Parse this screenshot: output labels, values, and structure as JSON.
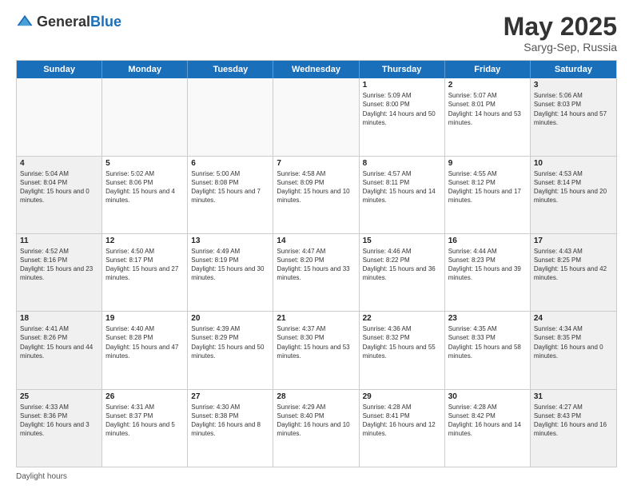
{
  "header": {
    "logo_general": "General",
    "logo_blue": "Blue",
    "title": "May 2025",
    "location": "Saryg-Sep, Russia"
  },
  "calendar": {
    "days": [
      "Sunday",
      "Monday",
      "Tuesday",
      "Wednesday",
      "Thursday",
      "Friday",
      "Saturday"
    ],
    "rows": [
      [
        {
          "day": "",
          "content": ""
        },
        {
          "day": "",
          "content": ""
        },
        {
          "day": "",
          "content": ""
        },
        {
          "day": "",
          "content": ""
        },
        {
          "day": "1",
          "content": "Sunrise: 5:09 AM\nSunset: 8:00 PM\nDaylight: 14 hours and 50 minutes."
        },
        {
          "day": "2",
          "content": "Sunrise: 5:07 AM\nSunset: 8:01 PM\nDaylight: 14 hours and 53 minutes."
        },
        {
          "day": "3",
          "content": "Sunrise: 5:06 AM\nSunset: 8:03 PM\nDaylight: 14 hours and 57 minutes."
        }
      ],
      [
        {
          "day": "4",
          "content": "Sunrise: 5:04 AM\nSunset: 8:04 PM\nDaylight: 15 hours and 0 minutes."
        },
        {
          "day": "5",
          "content": "Sunrise: 5:02 AM\nSunset: 8:06 PM\nDaylight: 15 hours and 4 minutes."
        },
        {
          "day": "6",
          "content": "Sunrise: 5:00 AM\nSunset: 8:08 PM\nDaylight: 15 hours and 7 minutes."
        },
        {
          "day": "7",
          "content": "Sunrise: 4:58 AM\nSunset: 8:09 PM\nDaylight: 15 hours and 10 minutes."
        },
        {
          "day": "8",
          "content": "Sunrise: 4:57 AM\nSunset: 8:11 PM\nDaylight: 15 hours and 14 minutes."
        },
        {
          "day": "9",
          "content": "Sunrise: 4:55 AM\nSunset: 8:12 PM\nDaylight: 15 hours and 17 minutes."
        },
        {
          "day": "10",
          "content": "Sunrise: 4:53 AM\nSunset: 8:14 PM\nDaylight: 15 hours and 20 minutes."
        }
      ],
      [
        {
          "day": "11",
          "content": "Sunrise: 4:52 AM\nSunset: 8:16 PM\nDaylight: 15 hours and 23 minutes."
        },
        {
          "day": "12",
          "content": "Sunrise: 4:50 AM\nSunset: 8:17 PM\nDaylight: 15 hours and 27 minutes."
        },
        {
          "day": "13",
          "content": "Sunrise: 4:49 AM\nSunset: 8:19 PM\nDaylight: 15 hours and 30 minutes."
        },
        {
          "day": "14",
          "content": "Sunrise: 4:47 AM\nSunset: 8:20 PM\nDaylight: 15 hours and 33 minutes."
        },
        {
          "day": "15",
          "content": "Sunrise: 4:46 AM\nSunset: 8:22 PM\nDaylight: 15 hours and 36 minutes."
        },
        {
          "day": "16",
          "content": "Sunrise: 4:44 AM\nSunset: 8:23 PM\nDaylight: 15 hours and 39 minutes."
        },
        {
          "day": "17",
          "content": "Sunrise: 4:43 AM\nSunset: 8:25 PM\nDaylight: 15 hours and 42 minutes."
        }
      ],
      [
        {
          "day": "18",
          "content": "Sunrise: 4:41 AM\nSunset: 8:26 PM\nDaylight: 15 hours and 44 minutes."
        },
        {
          "day": "19",
          "content": "Sunrise: 4:40 AM\nSunset: 8:28 PM\nDaylight: 15 hours and 47 minutes."
        },
        {
          "day": "20",
          "content": "Sunrise: 4:39 AM\nSunset: 8:29 PM\nDaylight: 15 hours and 50 minutes."
        },
        {
          "day": "21",
          "content": "Sunrise: 4:37 AM\nSunset: 8:30 PM\nDaylight: 15 hours and 53 minutes."
        },
        {
          "day": "22",
          "content": "Sunrise: 4:36 AM\nSunset: 8:32 PM\nDaylight: 15 hours and 55 minutes."
        },
        {
          "day": "23",
          "content": "Sunrise: 4:35 AM\nSunset: 8:33 PM\nDaylight: 15 hours and 58 minutes."
        },
        {
          "day": "24",
          "content": "Sunrise: 4:34 AM\nSunset: 8:35 PM\nDaylight: 16 hours and 0 minutes."
        }
      ],
      [
        {
          "day": "25",
          "content": "Sunrise: 4:33 AM\nSunset: 8:36 PM\nDaylight: 16 hours and 3 minutes."
        },
        {
          "day": "26",
          "content": "Sunrise: 4:31 AM\nSunset: 8:37 PM\nDaylight: 16 hours and 5 minutes."
        },
        {
          "day": "27",
          "content": "Sunrise: 4:30 AM\nSunset: 8:38 PM\nDaylight: 16 hours and 8 minutes."
        },
        {
          "day": "28",
          "content": "Sunrise: 4:29 AM\nSunset: 8:40 PM\nDaylight: 16 hours and 10 minutes."
        },
        {
          "day": "29",
          "content": "Sunrise: 4:28 AM\nSunset: 8:41 PM\nDaylight: 16 hours and 12 minutes."
        },
        {
          "day": "30",
          "content": "Sunrise: 4:28 AM\nSunset: 8:42 PM\nDaylight: 16 hours and 14 minutes."
        },
        {
          "day": "31",
          "content": "Sunrise: 4:27 AM\nSunset: 8:43 PM\nDaylight: 16 hours and 16 minutes."
        }
      ]
    ]
  },
  "footer": {
    "text": "Daylight hours"
  }
}
